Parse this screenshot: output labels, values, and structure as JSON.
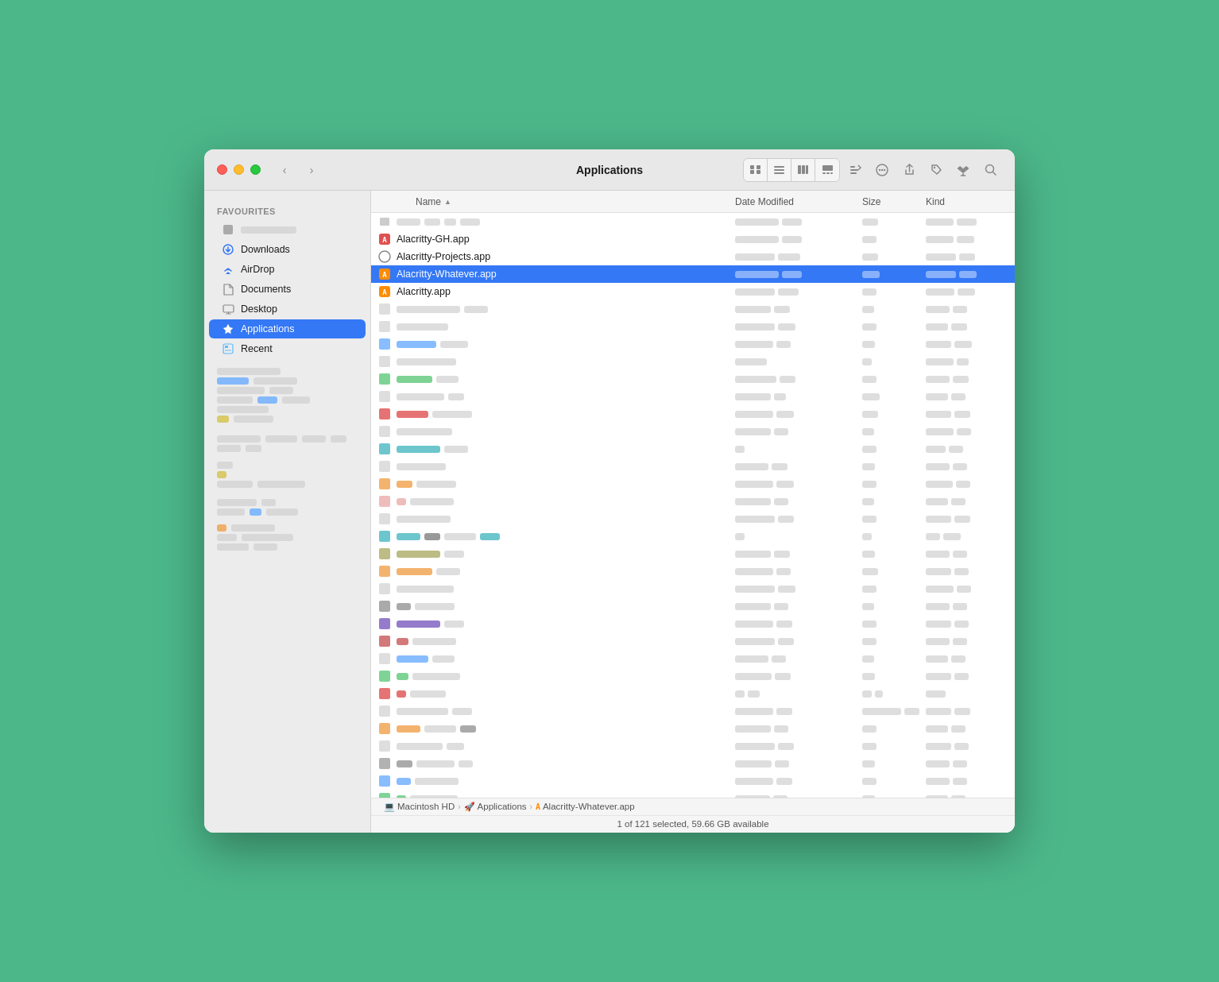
{
  "window": {
    "title": "Applications"
  },
  "toolbar": {
    "back_label": "‹",
    "forward_label": "›",
    "view_icon": "⊞",
    "view_list": "≡",
    "view_column": "⊟",
    "view_gallery": "⊠",
    "view_group": "⊞",
    "action_btn": "···",
    "share_btn": "↑",
    "tag_btn": "◇",
    "dropbox_btn": "☁",
    "search_btn": "⌕"
  },
  "sidebar": {
    "favourites_label": "Favourites",
    "recent_label": "Recent",
    "items": [
      {
        "id": "downloads",
        "label": "Downloads",
        "icon": "⬇",
        "color": "#3478f6"
      },
      {
        "id": "airdrop",
        "label": "AirDrop",
        "icon": "📡",
        "color": "#3478f6"
      },
      {
        "id": "documents",
        "label": "Documents",
        "icon": "📄",
        "color": "#888"
      },
      {
        "id": "desktop",
        "label": "Desktop",
        "icon": "🖥",
        "color": "#888"
      },
      {
        "id": "applications",
        "label": "Applications",
        "icon": "🚀",
        "color": "#3478f6",
        "active": true
      }
    ]
  },
  "columns": {
    "name": "Name",
    "date_modified": "Date Modified",
    "size": "Size",
    "kind": "Kind"
  },
  "files": [
    {
      "id": 1,
      "name": "Alacritty-GH.app",
      "icon": "◆",
      "icon_color": "#e05050",
      "selected": false,
      "has_real_name": true
    },
    {
      "id": 2,
      "name": "Alacritty-Projects.app",
      "icon": "○",
      "icon_color": "#aaa",
      "selected": false,
      "has_real_name": true
    },
    {
      "id": 3,
      "name": "Alacritty-Whatever.app",
      "icon": "A",
      "icon_color": "#ff8c00",
      "selected": true,
      "has_real_name": true
    },
    {
      "id": 4,
      "name": "Alacritty.app",
      "icon": "A",
      "icon_color": "#ff8c00",
      "selected": false,
      "has_real_name": true
    }
  ],
  "statusbar": {
    "breadcrumb": [
      {
        "label": "Macintosh HD",
        "icon": "💻"
      },
      {
        "label": "Applications",
        "icon": "🚀"
      },
      {
        "label": "Alacritty-Whatever.app",
        "icon": "A"
      }
    ],
    "status_text": "1 of 121 selected, 59.66 GB available"
  }
}
